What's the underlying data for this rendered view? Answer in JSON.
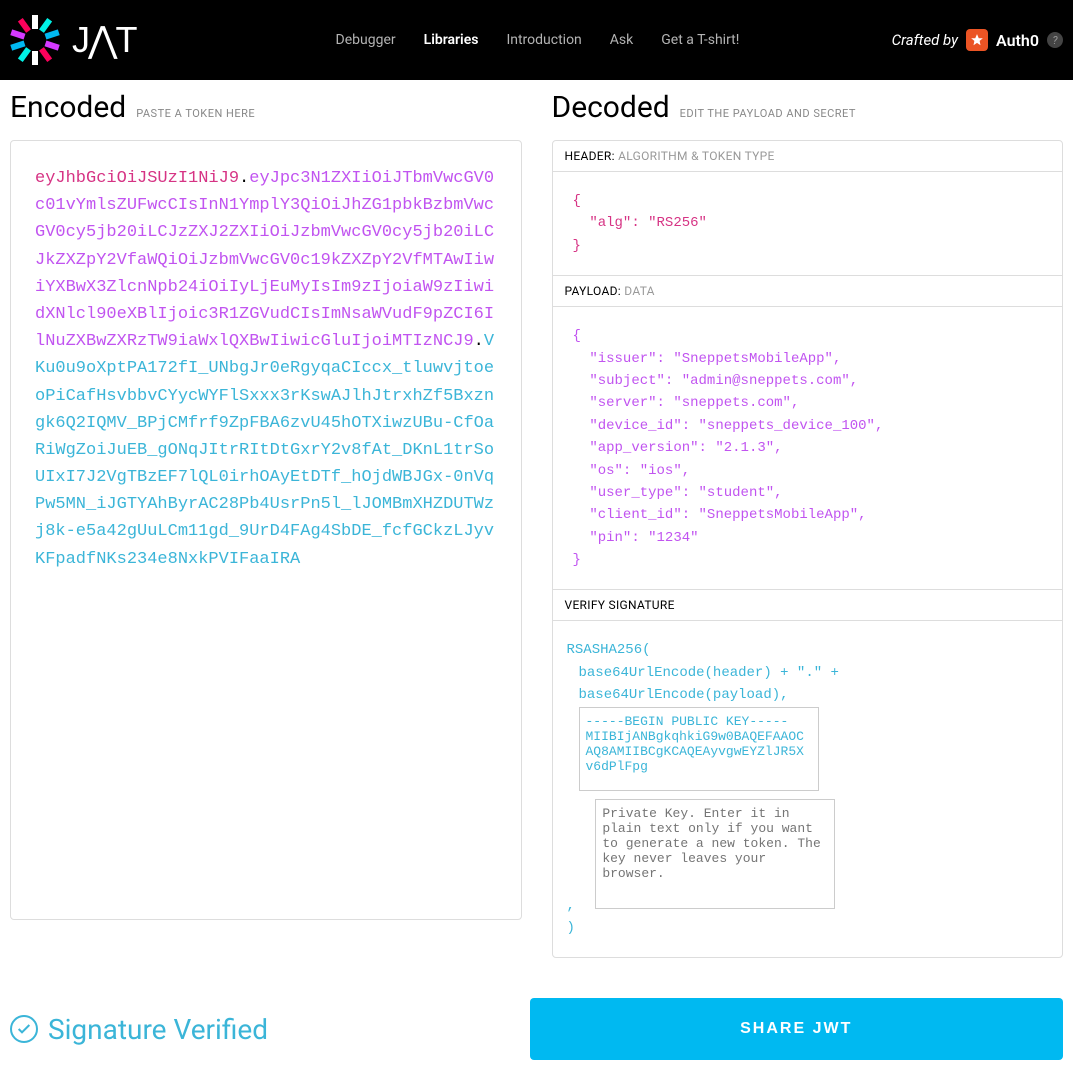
{
  "nav": {
    "links": [
      "Debugger",
      "Libraries",
      "Introduction",
      "Ask",
      "Get a T-shirt!"
    ],
    "active": "Libraries",
    "crafted_by": "Crafted by",
    "auth0": "Auth0"
  },
  "encoded": {
    "title": "Encoded",
    "subtitle": "PASTE A TOKEN HERE",
    "token_header": "eyJhbGciOiJSUzI1NiJ9",
    "token_payload": "eyJpc3N1ZXIiOiJTbmVwcGV0c01vYmlsZUFwcCIsInN1YmplY3QiOiJhZG1pbkBzbmVwcGV0cy5jb20iLCJzZXJ2ZXIiOiJzbmVwcGV0cy5jb20iLCJkZXZpY2VfaWQiOiJzbmVwcGV0c19kZXZpY2VfMTAwIiwiYXBwX3ZlcnNpb24iOiIyLjEuMyIsIm9zIjoiaW9zIiwidXNlcl90eXBlIjoic3R1ZGVudCIsImNsaWVudF9pZCI6IlNuZXBwZXRzTW9iaWxlQXBwIiwicGluIjoiMTIzNCJ9",
    "token_signature": "VKu0u9oXptPA172fI_UNbgJr0eRgyqaCIccx_tluwvjtoeoPiCafHsvbbvCYycWYFlSxxx3rKswAJlhJtrxhZf5Bxzngk6Q2IQMV_BPjCMfrf9ZpFBA6zvU45hOTXiwzUBu-CfOaRiWgZoiJuEB_gONqJItrRItDtGxrY2v8fAt_DKnL1trSoUIxI7J2VgTBzEF7lQL0irhOAyEtDTf_hOjdWBJGx-0nVqPw5MN_iJGTYAhByrAC28Pb4UsrPn5l_lJOMBmXHZDUTWzj8k-e5a42gUuLCm11gd_9UrD4FAg4SbDE_fcfGCkzLJyvKFpadfNKs234e8NxkPVIFaaIRA"
  },
  "decoded": {
    "title": "Decoded",
    "subtitle": "EDIT THE PAYLOAD AND SECRET",
    "header_label": "HEADER:",
    "header_sub": "ALGORITHM & TOKEN TYPE",
    "header_json": "{\n  \"alg\": \"RS256\"\n}",
    "payload_label": "PAYLOAD:",
    "payload_sub": "DATA",
    "payload_json": "{\n  \"issuer\": \"SneppetsMobileApp\",\n  \"subject\": \"admin@sneppets.com\",\n  \"server\": \"sneppets.com\",\n  \"device_id\": \"sneppets_device_100\",\n  \"app_version\": \"2.1.3\",\n  \"os\": \"ios\",\n  \"user_type\": \"student\",\n  \"client_id\": \"SneppetsMobileApp\",\n  \"pin\": \"1234\"\n}",
    "verify_label": "VERIFY SIGNATURE",
    "verify_algo": "RSASHA256(",
    "verify_line1": "base64UrlEncode(header) + \".\" +",
    "verify_line2": "base64UrlEncode(payload),",
    "public_key": "-----BEGIN PUBLIC KEY-----\nMIIBIjANBgkqhkiG9w0BAQEFAAOCAQ8AMIIBCgKCAQEAyvgwEYZlJR5Xv6dPlFpg",
    "private_key_placeholder": "Private Key. Enter it in plain text only if you want to generate a new token. The key never leaves your browser.",
    "verify_close": ")"
  },
  "status": {
    "verified": "Signature Verified",
    "share": "SHARE JWT"
  }
}
